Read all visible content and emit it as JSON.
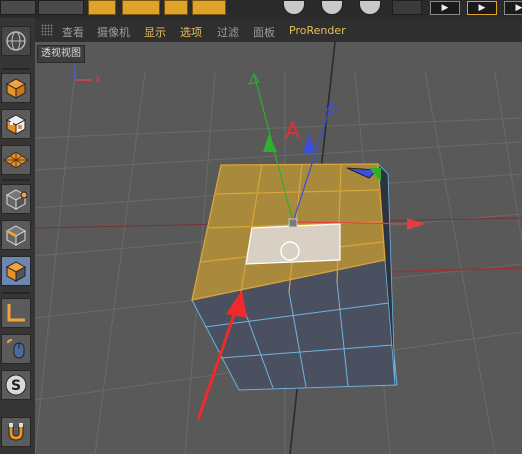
{
  "menu": {
    "items": [
      {
        "label": "查看",
        "active": false
      },
      {
        "label": "摄像机",
        "active": false
      },
      {
        "label": "显示",
        "active": false
      },
      {
        "label": "选项",
        "active": true
      },
      {
        "label": "过滤",
        "active": false
      },
      {
        "label": "面板",
        "active": false
      },
      {
        "label": "ProRender",
        "active": false
      }
    ],
    "active_color": "#e7c05a"
  },
  "viewport": {
    "label": "透视视图",
    "axis_marker_x": "x",
    "annotation": "A",
    "selection_color": "#d9a53a",
    "highlight_color": "#ffffff"
  },
  "toolbar": {
    "play_glyph": "▶"
  }
}
